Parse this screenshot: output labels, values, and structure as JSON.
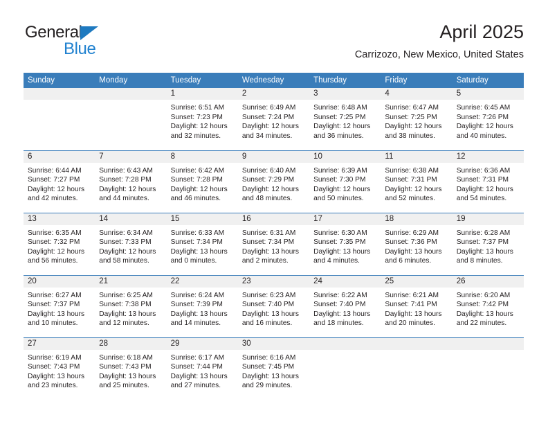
{
  "brand": {
    "name_dark": "General",
    "name_blue": "Blue",
    "dark_color": "#231f20",
    "blue_color": "#2081cf"
  },
  "header": {
    "title": "April 2025",
    "subtitle": "Carrizozo, New Mexico, United States"
  },
  "theme": {
    "header_blue": "#3a7dba",
    "daynum_background": "#f0f0f0",
    "row_divider": "#3a7dba",
    "text": "#231f20"
  },
  "weekday_headers": [
    "Sunday",
    "Monday",
    "Tuesday",
    "Wednesday",
    "Thursday",
    "Friday",
    "Saturday"
  ],
  "weeks": [
    [
      {
        "day": "",
        "empty": true,
        "sunrise": "",
        "sunset": "",
        "daylight_line1": "",
        "daylight_line2": ""
      },
      {
        "day": "",
        "empty": true,
        "sunrise": "",
        "sunset": "",
        "daylight_line1": "",
        "daylight_line2": ""
      },
      {
        "day": "1",
        "empty": false,
        "sunrise": "Sunrise: 6:51 AM",
        "sunset": "Sunset: 7:23 PM",
        "daylight_line1": "Daylight: 12 hours",
        "daylight_line2": "and 32 minutes."
      },
      {
        "day": "2",
        "empty": false,
        "sunrise": "Sunrise: 6:49 AM",
        "sunset": "Sunset: 7:24 PM",
        "daylight_line1": "Daylight: 12 hours",
        "daylight_line2": "and 34 minutes."
      },
      {
        "day": "3",
        "empty": false,
        "sunrise": "Sunrise: 6:48 AM",
        "sunset": "Sunset: 7:25 PM",
        "daylight_line1": "Daylight: 12 hours",
        "daylight_line2": "and 36 minutes."
      },
      {
        "day": "4",
        "empty": false,
        "sunrise": "Sunrise: 6:47 AM",
        "sunset": "Sunset: 7:25 PM",
        "daylight_line1": "Daylight: 12 hours",
        "daylight_line2": "and 38 minutes."
      },
      {
        "day": "5",
        "empty": false,
        "sunrise": "Sunrise: 6:45 AM",
        "sunset": "Sunset: 7:26 PM",
        "daylight_line1": "Daylight: 12 hours",
        "daylight_line2": "and 40 minutes."
      }
    ],
    [
      {
        "day": "6",
        "empty": false,
        "sunrise": "Sunrise: 6:44 AM",
        "sunset": "Sunset: 7:27 PM",
        "daylight_line1": "Daylight: 12 hours",
        "daylight_line2": "and 42 minutes."
      },
      {
        "day": "7",
        "empty": false,
        "sunrise": "Sunrise: 6:43 AM",
        "sunset": "Sunset: 7:28 PM",
        "daylight_line1": "Daylight: 12 hours",
        "daylight_line2": "and 44 minutes."
      },
      {
        "day": "8",
        "empty": false,
        "sunrise": "Sunrise: 6:42 AM",
        "sunset": "Sunset: 7:28 PM",
        "daylight_line1": "Daylight: 12 hours",
        "daylight_line2": "and 46 minutes."
      },
      {
        "day": "9",
        "empty": false,
        "sunrise": "Sunrise: 6:40 AM",
        "sunset": "Sunset: 7:29 PM",
        "daylight_line1": "Daylight: 12 hours",
        "daylight_line2": "and 48 minutes."
      },
      {
        "day": "10",
        "empty": false,
        "sunrise": "Sunrise: 6:39 AM",
        "sunset": "Sunset: 7:30 PM",
        "daylight_line1": "Daylight: 12 hours",
        "daylight_line2": "and 50 minutes."
      },
      {
        "day": "11",
        "empty": false,
        "sunrise": "Sunrise: 6:38 AM",
        "sunset": "Sunset: 7:31 PM",
        "daylight_line1": "Daylight: 12 hours",
        "daylight_line2": "and 52 minutes."
      },
      {
        "day": "12",
        "empty": false,
        "sunrise": "Sunrise: 6:36 AM",
        "sunset": "Sunset: 7:31 PM",
        "daylight_line1": "Daylight: 12 hours",
        "daylight_line2": "and 54 minutes."
      }
    ],
    [
      {
        "day": "13",
        "empty": false,
        "sunrise": "Sunrise: 6:35 AM",
        "sunset": "Sunset: 7:32 PM",
        "daylight_line1": "Daylight: 12 hours",
        "daylight_line2": "and 56 minutes."
      },
      {
        "day": "14",
        "empty": false,
        "sunrise": "Sunrise: 6:34 AM",
        "sunset": "Sunset: 7:33 PM",
        "daylight_line1": "Daylight: 12 hours",
        "daylight_line2": "and 58 minutes."
      },
      {
        "day": "15",
        "empty": false,
        "sunrise": "Sunrise: 6:33 AM",
        "sunset": "Sunset: 7:34 PM",
        "daylight_line1": "Daylight: 13 hours",
        "daylight_line2": "and 0 minutes."
      },
      {
        "day": "16",
        "empty": false,
        "sunrise": "Sunrise: 6:31 AM",
        "sunset": "Sunset: 7:34 PM",
        "daylight_line1": "Daylight: 13 hours",
        "daylight_line2": "and 2 minutes."
      },
      {
        "day": "17",
        "empty": false,
        "sunrise": "Sunrise: 6:30 AM",
        "sunset": "Sunset: 7:35 PM",
        "daylight_line1": "Daylight: 13 hours",
        "daylight_line2": "and 4 minutes."
      },
      {
        "day": "18",
        "empty": false,
        "sunrise": "Sunrise: 6:29 AM",
        "sunset": "Sunset: 7:36 PM",
        "daylight_line1": "Daylight: 13 hours",
        "daylight_line2": "and 6 minutes."
      },
      {
        "day": "19",
        "empty": false,
        "sunrise": "Sunrise: 6:28 AM",
        "sunset": "Sunset: 7:37 PM",
        "daylight_line1": "Daylight: 13 hours",
        "daylight_line2": "and 8 minutes."
      }
    ],
    [
      {
        "day": "20",
        "empty": false,
        "sunrise": "Sunrise: 6:27 AM",
        "sunset": "Sunset: 7:37 PM",
        "daylight_line1": "Daylight: 13 hours",
        "daylight_line2": "and 10 minutes."
      },
      {
        "day": "21",
        "empty": false,
        "sunrise": "Sunrise: 6:25 AM",
        "sunset": "Sunset: 7:38 PM",
        "daylight_line1": "Daylight: 13 hours",
        "daylight_line2": "and 12 minutes."
      },
      {
        "day": "22",
        "empty": false,
        "sunrise": "Sunrise: 6:24 AM",
        "sunset": "Sunset: 7:39 PM",
        "daylight_line1": "Daylight: 13 hours",
        "daylight_line2": "and 14 minutes."
      },
      {
        "day": "23",
        "empty": false,
        "sunrise": "Sunrise: 6:23 AM",
        "sunset": "Sunset: 7:40 PM",
        "daylight_line1": "Daylight: 13 hours",
        "daylight_line2": "and 16 minutes."
      },
      {
        "day": "24",
        "empty": false,
        "sunrise": "Sunrise: 6:22 AM",
        "sunset": "Sunset: 7:40 PM",
        "daylight_line1": "Daylight: 13 hours",
        "daylight_line2": "and 18 minutes."
      },
      {
        "day": "25",
        "empty": false,
        "sunrise": "Sunrise: 6:21 AM",
        "sunset": "Sunset: 7:41 PM",
        "daylight_line1": "Daylight: 13 hours",
        "daylight_line2": "and 20 minutes."
      },
      {
        "day": "26",
        "empty": false,
        "sunrise": "Sunrise: 6:20 AM",
        "sunset": "Sunset: 7:42 PM",
        "daylight_line1": "Daylight: 13 hours",
        "daylight_line2": "and 22 minutes."
      }
    ],
    [
      {
        "day": "27",
        "empty": false,
        "sunrise": "Sunrise: 6:19 AM",
        "sunset": "Sunset: 7:43 PM",
        "daylight_line1": "Daylight: 13 hours",
        "daylight_line2": "and 23 minutes."
      },
      {
        "day": "28",
        "empty": false,
        "sunrise": "Sunrise: 6:18 AM",
        "sunset": "Sunset: 7:43 PM",
        "daylight_line1": "Daylight: 13 hours",
        "daylight_line2": "and 25 minutes."
      },
      {
        "day": "29",
        "empty": false,
        "sunrise": "Sunrise: 6:17 AM",
        "sunset": "Sunset: 7:44 PM",
        "daylight_line1": "Daylight: 13 hours",
        "daylight_line2": "and 27 minutes."
      },
      {
        "day": "30",
        "empty": false,
        "sunrise": "Sunrise: 6:16 AM",
        "sunset": "Sunset: 7:45 PM",
        "daylight_line1": "Daylight: 13 hours",
        "daylight_line2": "and 29 minutes."
      },
      {
        "day": "",
        "empty": true,
        "sunrise": "",
        "sunset": "",
        "daylight_line1": "",
        "daylight_line2": ""
      },
      {
        "day": "",
        "empty": true,
        "sunrise": "",
        "sunset": "",
        "daylight_line1": "",
        "daylight_line2": ""
      },
      {
        "day": "",
        "empty": true,
        "sunrise": "",
        "sunset": "",
        "daylight_line1": "",
        "daylight_line2": ""
      }
    ]
  ]
}
